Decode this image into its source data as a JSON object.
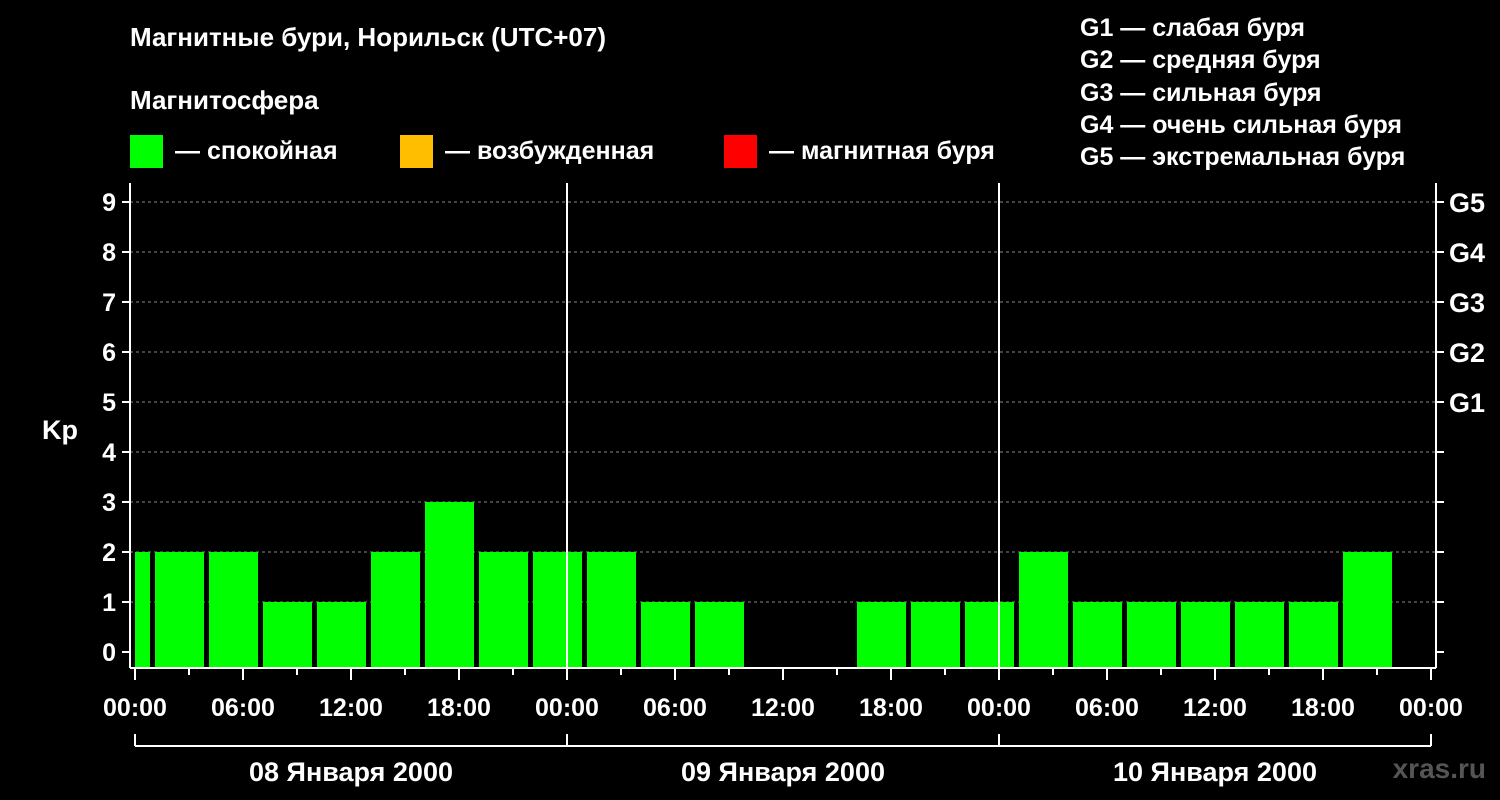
{
  "header": {
    "title": "Магнитные бури, Норильск (UTC+07)",
    "subtitle": "Магнитосфера"
  },
  "legend": [
    {
      "label": "— спокойная",
      "color": "#00ff00"
    },
    {
      "label": "— возбужденная",
      "color": "#ffbf00"
    },
    {
      "label": "— магнитная буря",
      "color": "#ff0000"
    }
  ],
  "storm_legend": [
    "G1 — слабая буря",
    "G2 — средняя буря",
    "G3 — сильная буря",
    "G4 — очень сильная буря",
    "G5 — экстремальная буря"
  ],
  "watermark": "xras.ru",
  "chart_data": {
    "type": "bar",
    "ylabel": "Kp",
    "ylim": [
      0,
      9
    ],
    "yticks": [
      "0",
      "1",
      "2",
      "3",
      "4",
      "5",
      "6",
      "7",
      "8",
      "9"
    ],
    "right_axis_labels": [
      {
        "kp": 5,
        "label": "G1"
      },
      {
        "kp": 6,
        "label": "G2"
      },
      {
        "kp": 7,
        "label": "G3"
      },
      {
        "kp": 8,
        "label": "G4"
      },
      {
        "kp": 9,
        "label": "G5"
      }
    ],
    "grid": "dashed horizontal",
    "x_range_hours": [
      0,
      72
    ],
    "xticks": [
      "00:00",
      "06:00",
      "12:00",
      "18:00",
      "00:00",
      "06:00",
      "12:00",
      "18:00",
      "00:00",
      "06:00",
      "12:00",
      "18:00",
      "00:00"
    ],
    "day_labels": [
      "08 Января 2000",
      "09 Января 2000",
      "10 Января 2000"
    ],
    "color_quiet": "#00ff00",
    "bars": [
      {
        "start": 0,
        "end": 1,
        "kp": 2
      },
      {
        "start": 1,
        "end": 4,
        "kp": 2
      },
      {
        "start": 4,
        "end": 7,
        "kp": 2
      },
      {
        "start": 7,
        "end": 10,
        "kp": 1
      },
      {
        "start": 10,
        "end": 13,
        "kp": 1
      },
      {
        "start": 13,
        "end": 16,
        "kp": 2
      },
      {
        "start": 16,
        "end": 19,
        "kp": 3
      },
      {
        "start": 19,
        "end": 22,
        "kp": 2
      },
      {
        "start": 22,
        "end": 25,
        "kp": 2
      },
      {
        "start": 25,
        "end": 28,
        "kp": 2
      },
      {
        "start": 28,
        "end": 31,
        "kp": 1
      },
      {
        "start": 31,
        "end": 34,
        "kp": 1
      },
      {
        "start": 34,
        "end": 37,
        "kp": 0
      },
      {
        "start": 37,
        "end": 40,
        "kp": 0
      },
      {
        "start": 40,
        "end": 43,
        "kp": 1
      },
      {
        "start": 43,
        "end": 46,
        "kp": 1
      },
      {
        "start": 46,
        "end": 49,
        "kp": 1
      },
      {
        "start": 49,
        "end": 52,
        "kp": 2
      },
      {
        "start": 52,
        "end": 55,
        "kp": 1
      },
      {
        "start": 55,
        "end": 58,
        "kp": 1
      },
      {
        "start": 58,
        "end": 61,
        "kp": 1
      },
      {
        "start": 61,
        "end": 64,
        "kp": 1
      },
      {
        "start": 64,
        "end": 67,
        "kp": 1
      },
      {
        "start": 67,
        "end": 70,
        "kp": 2
      }
    ]
  }
}
